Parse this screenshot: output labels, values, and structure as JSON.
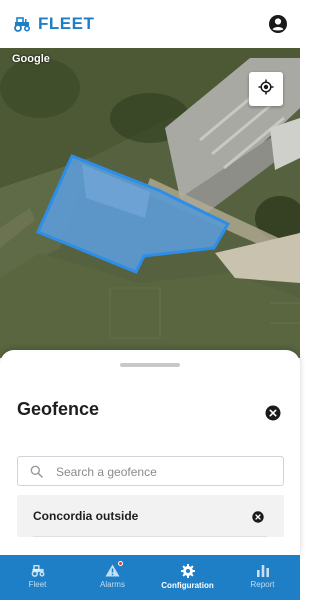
{
  "header": {
    "brand": "FLEET",
    "logo_icon": "tractor-icon",
    "account_icon": "account-circle-icon",
    "brand_color": "#1f7fc6"
  },
  "map": {
    "provider_label": "Google",
    "locate_icon": "my-location-icon",
    "geofence_color": "#2d8ee8"
  },
  "sheet": {
    "title": "Geofence",
    "close_icon": "close-circle-icon",
    "search": {
      "placeholder": "Search a geofence",
      "value": ""
    },
    "items": [
      {
        "label": "Concordia outside",
        "action_icon": "close-circle-icon"
      }
    ]
  },
  "nav": {
    "items": [
      {
        "label": "Fleet",
        "icon": "tractor-icon",
        "active": false
      },
      {
        "label": "Alarms",
        "icon": "warning-icon",
        "active": false,
        "has_badge": true
      },
      {
        "label": "Configuration",
        "icon": "gear-icon",
        "active": true
      },
      {
        "label": "Report",
        "icon": "bar-chart-icon",
        "active": false
      }
    ],
    "background": "#1f7fc6"
  }
}
